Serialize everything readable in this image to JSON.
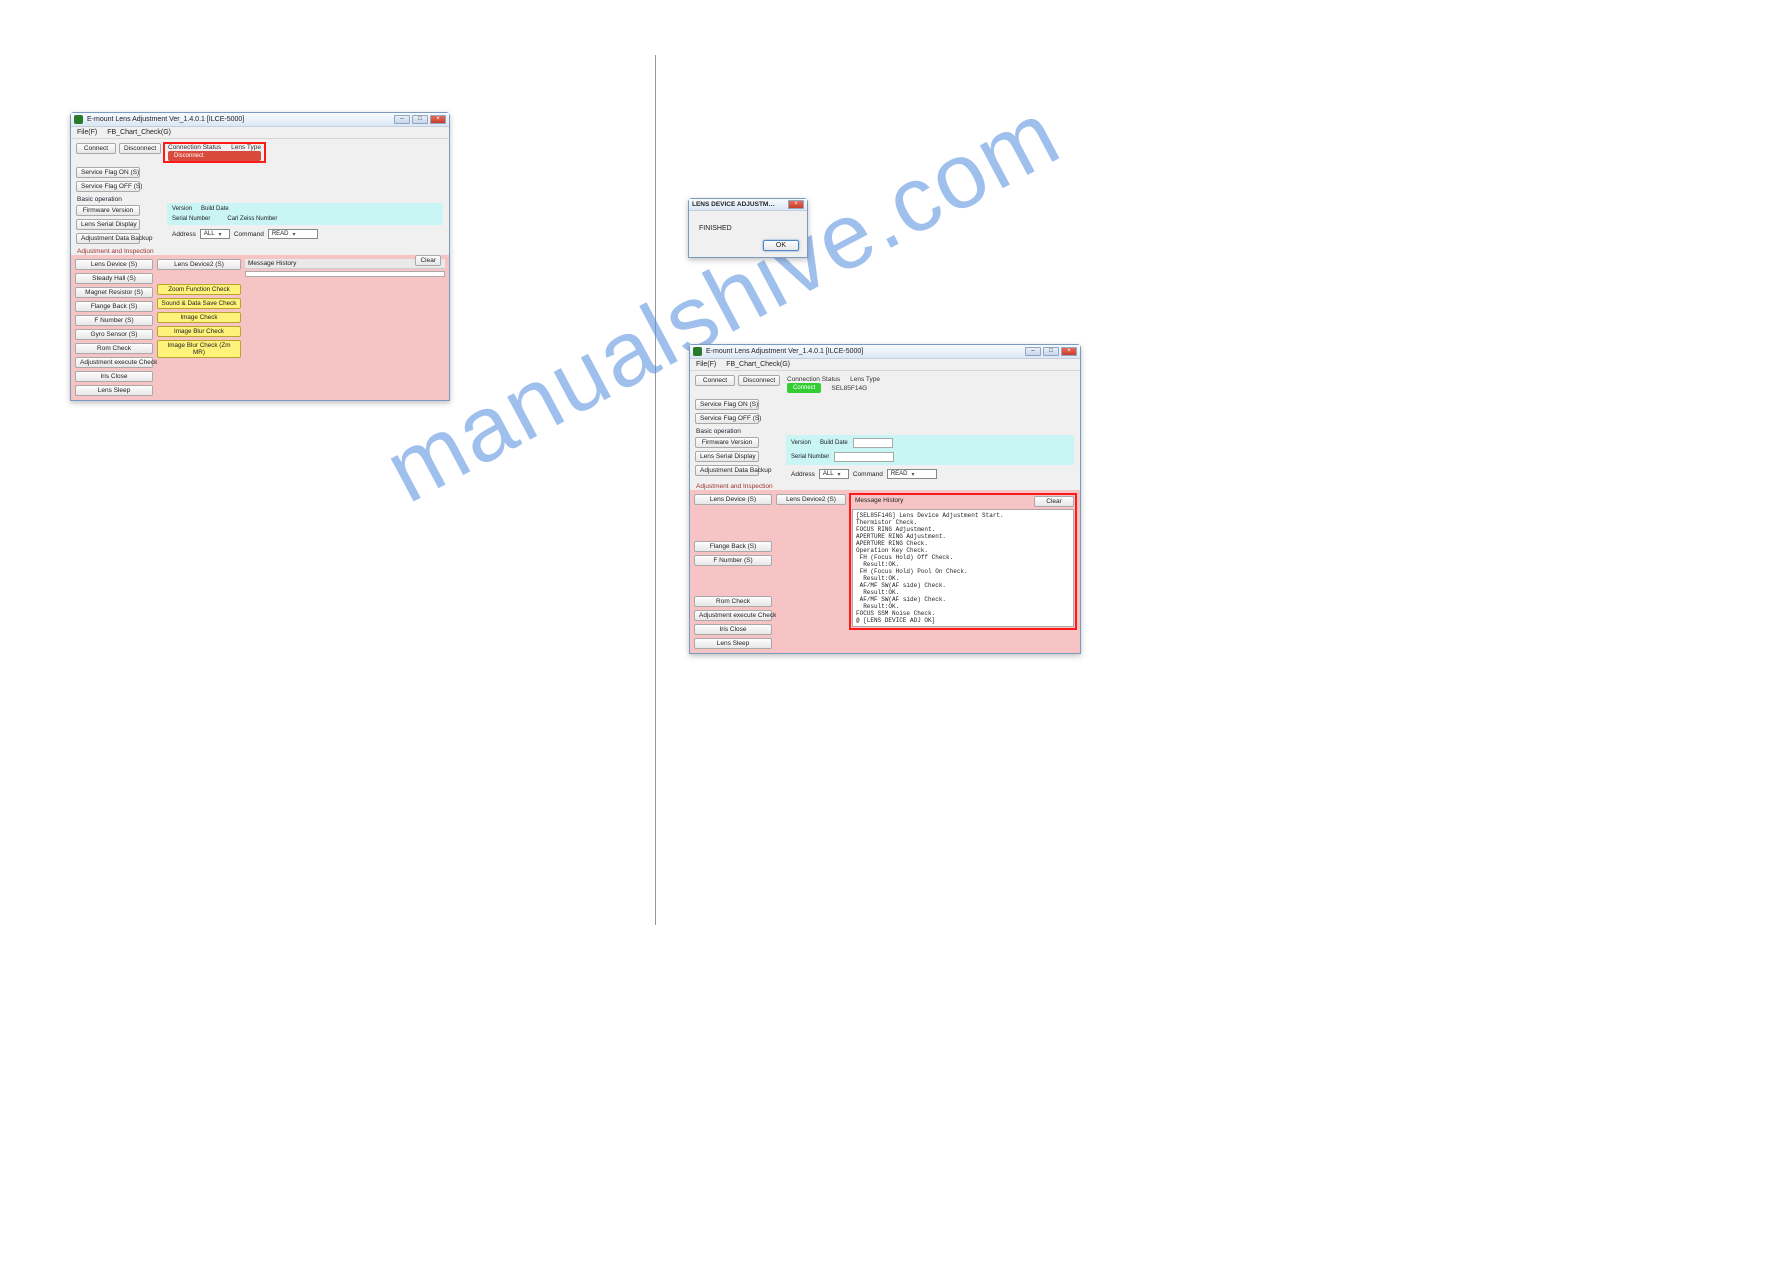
{
  "watermark": "manualshive.com",
  "win1": {
    "title": "E-mount Lens Adjustment  Ver_1.4.0.1 [ILCE-5000]",
    "menu": {
      "file": "File(F)",
      "chart": "FB_Chart_Check(G)"
    },
    "connect": "Connect",
    "disconnect": "Disconnect",
    "conn_status_lbl": "Connection Status",
    "lens_type_lbl": "Lens Type",
    "conn_status_val": "Disconnect",
    "svc_on": "Service Flag ON (S)",
    "svc_off": "Service Flag OFF (S)",
    "basic_lbl": "Basic operation",
    "fw": "Firmware Version",
    "serial_disp": "Lens Serial Display",
    "backup": "Adjustment Data Backup",
    "version_lbl": "Version",
    "build_lbl": "Build Date",
    "serial_lbl": "Serial Number",
    "zeiss_lbl": "Carl Zeiss Number",
    "addr_lbl": "Address",
    "addr_all": "ALL",
    "cmd_lbl": "Command",
    "cmd_read": "READ",
    "adj_lbl": "Adjustment and Inspection",
    "lens_dev": "Lens Device (S)",
    "lens_dev2": "Lens Device2 (S)",
    "steady": "Steady Hall (S)",
    "magnet": "Magnet Resistor (S)",
    "flange": "Flange Back (S)",
    "fnum": "F Number (S)",
    "gyro": "Gyro Sensor (S)",
    "rom": "Rom Check",
    "adj_exec": "Adjustment execute Check",
    "iris": "Iris Close",
    "sleep": "Lens Sleep",
    "zoom_fn": "Zoom Function Check",
    "sound": "Sound & Data Save Check",
    "img_chk": "Image Check",
    "img_blur": "Image Blur Check",
    "img_blur_zm": "Image Blur Check (Zm MR)",
    "msg_hist": "Message History",
    "clear": "Clear"
  },
  "dlg": {
    "title": "LENS DEVICE ADJUSTM…",
    "body": "FINISHED",
    "ok": "OK"
  },
  "win2": {
    "title": "E-mount Lens Adjustment  Ver_1.4.0.1 [ILCE-5000]",
    "menu": {
      "file": "File(F)",
      "chart": "FB_Chart_Check(G)"
    },
    "connect": "Connect",
    "disconnect": "Disconnect",
    "conn_status_lbl": "Connection Status",
    "lens_type_lbl": "Lens Type",
    "conn_status_val": "Connect",
    "lens_type_val": "SEL85F14G",
    "svc_on": "Service Flag ON (S)",
    "svc_off": "Service Flag OFF (S)",
    "basic_lbl": "Basic operation",
    "fw": "Firmware Version",
    "serial_disp": "Lens Serial Display",
    "backup": "Adjustment Data Backup",
    "version_lbl": "Version",
    "build_lbl": "Build Date",
    "serial_lbl": "Serial Number",
    "addr_lbl": "Address",
    "addr_all": "ALL",
    "cmd_lbl": "Command",
    "cmd_read": "READ",
    "adj_lbl": "Adjustment and Inspection",
    "lens_dev": "Lens Device (S)",
    "lens_dev2": "Lens Device2 (S)",
    "flange": "Flange Back (S)",
    "fnum": "F Number (S)",
    "rom": "Rom Check",
    "adj_exec": "Adjustment execute Check",
    "iris": "Iris Close",
    "sleep": "Lens Sleep",
    "msg_hist": "Message History",
    "clear": "Clear",
    "msg_body": "[SEL85F14G] Lens Device Adjustment Start.\nThermistor Check.\nFOCUS RING Adjustment.\nAPERTURE RING Adjustment.\nAPERTURE RING Check.\nOperation Key Check.\n FH (Focus Hold) Off Check.\n  Result:OK.\n FH (Focus Hold) Pool On Check.\n  Result:OK.\n AF/MF SW(AF side) Check.\n  Result:OK.\n AF/MF SW(AF side) Check.\n  Result:OK.\nFOCUS SSM Noise Check.\n@ [LENS DEVICE ADJ OK]"
  }
}
